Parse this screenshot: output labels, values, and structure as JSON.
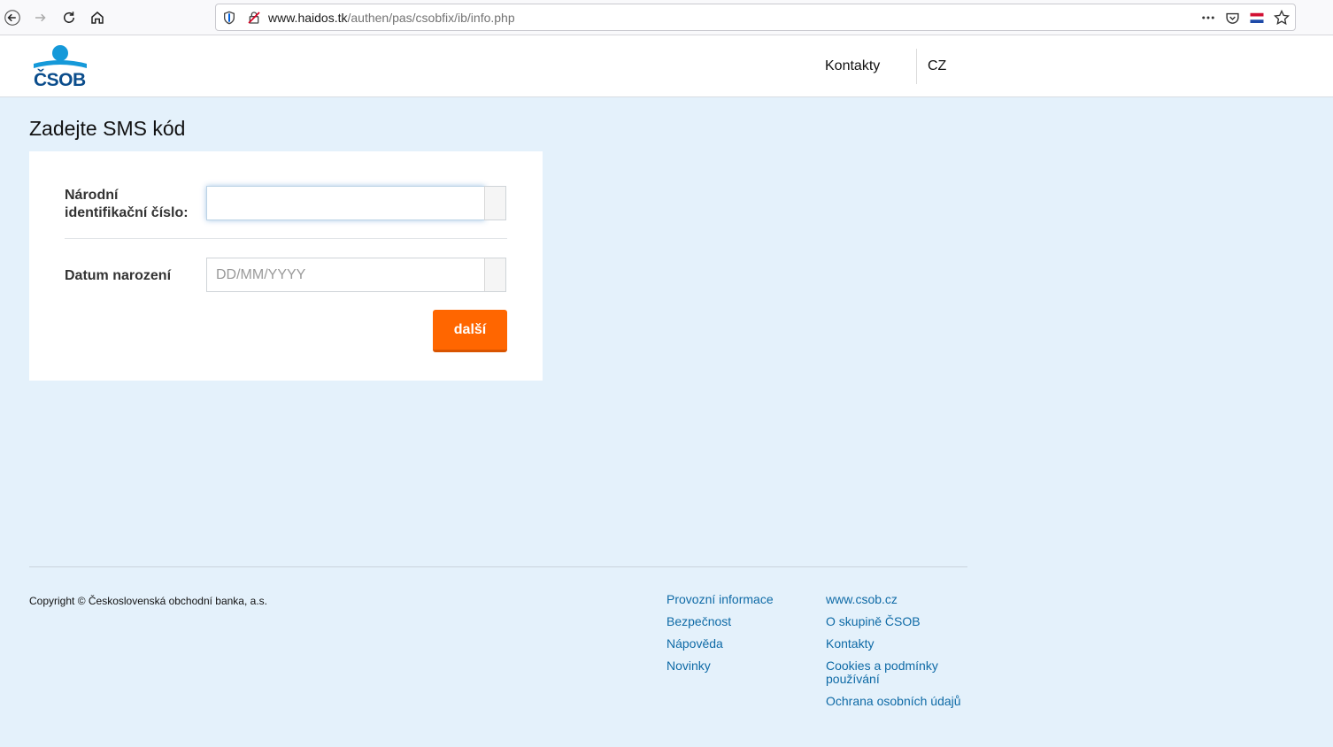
{
  "browser": {
    "url_host": "www.haidos.tk",
    "url_path": "/authen/pas/csobfix/ib/info.php",
    "icons": [
      "back-icon",
      "forward-icon",
      "reload-icon",
      "home-icon",
      "shield-icon",
      "insecure-lock-icon",
      "more-icon",
      "pocket-icon",
      "flag-icon",
      "bookmark-star-icon"
    ]
  },
  "header": {
    "logo_text": "ČSOB",
    "contacts_label": "Kontakty",
    "language_label": "CZ"
  },
  "main": {
    "title": "Zadejte SMS kód",
    "fields": [
      {
        "label_line1": "Národní",
        "label_line2": "identifikační číslo:",
        "value": "",
        "placeholder": ""
      },
      {
        "label": "Datum narození",
        "value": "",
        "placeholder": "DD/MM/YYYY"
      }
    ],
    "next_button": "další"
  },
  "footer": {
    "copyright": "Copyright © Československá obchodní banka, a.s.",
    "col1": [
      "Provozní informace",
      "Bezpečnost",
      "Nápověda",
      "Novinky"
    ],
    "col2": [
      "www.csob.cz",
      "O skupině ČSOB",
      "Kontakty",
      "Cookies a podmínky používání",
      "Ochrana osobních údajů"
    ]
  },
  "colors": {
    "accent_orange": "#ff6600",
    "link_blue": "#0e6aa6",
    "brand_blue": "#0b4d8c",
    "logo_light_blue": "#1599d9",
    "page_bg": "#e4f1fb"
  }
}
